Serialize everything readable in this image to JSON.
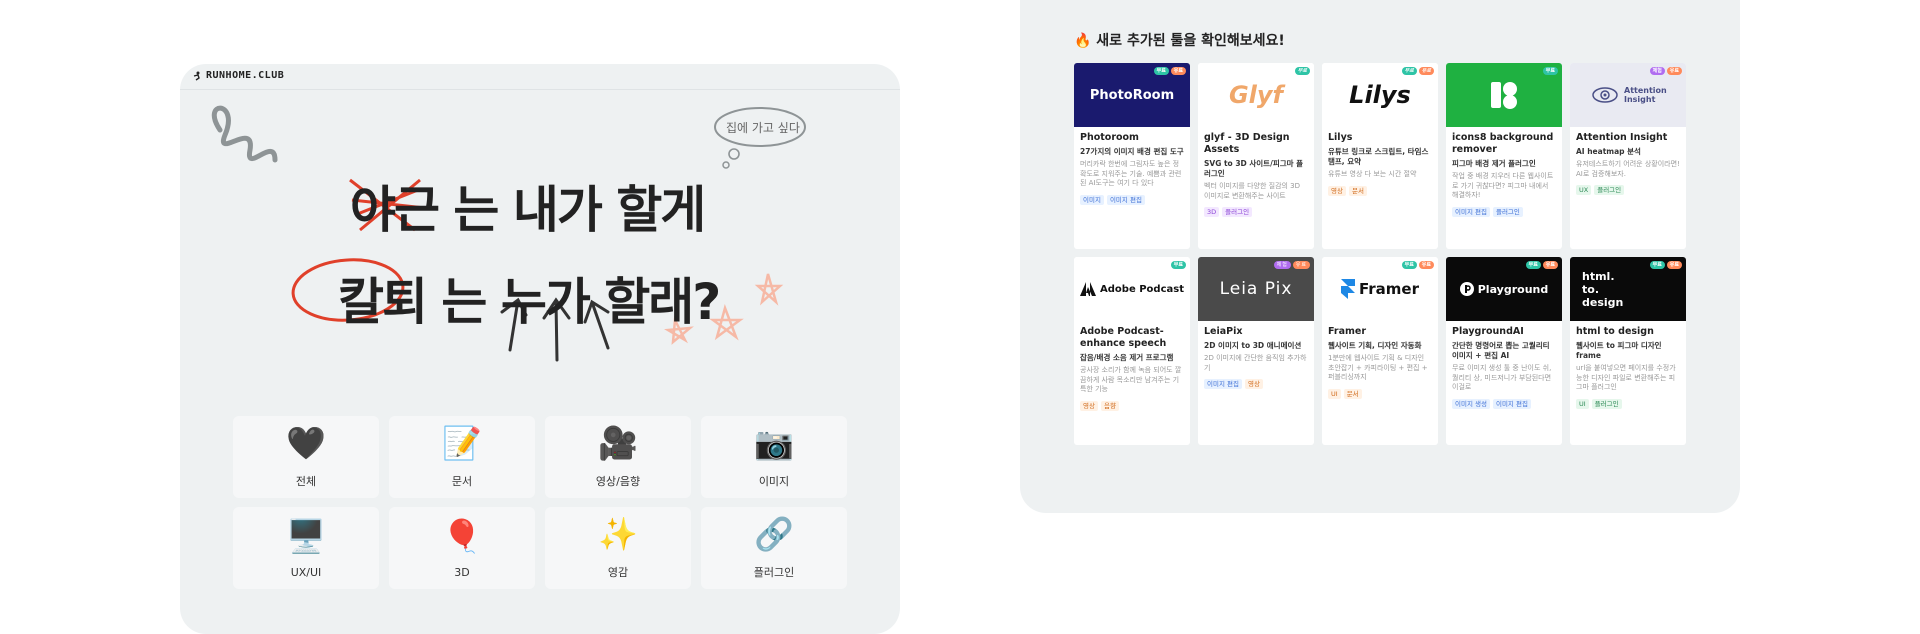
{
  "brand": {
    "name": "RUNHOME.CLUB"
  },
  "hero": {
    "scribble": "야근",
    "line1": "는 내가 할게",
    "line2_circled": "칼퇴",
    "line2": "는 누가 할래?",
    "bubble": "집에 가고 싶다"
  },
  "categories": [
    {
      "icon": "🖤",
      "label": "전체"
    },
    {
      "icon": "📝",
      "label": "문서"
    },
    {
      "icon": "🎥",
      "label": "영상/음향"
    },
    {
      "icon": "📷",
      "label": "이미지"
    },
    {
      "icon": "🖥️",
      "label": "UX/UI"
    },
    {
      "icon": "🎈",
      "label": "3D"
    },
    {
      "icon": "✨",
      "label": "영감"
    },
    {
      "icon": "🔗",
      "label": "플러그인"
    }
  ],
  "section": {
    "title": "🔥 새로 추가된 툴을 확인해보세요!"
  },
  "badges": {
    "free": "무료",
    "paid": "유료",
    "trial": "체험"
  },
  "tools": [
    {
      "logo": "PhotoRoom",
      "thumb_bg": "#1a1a6e",
      "thumb_fg": "#ffffff",
      "name": "Photoroom",
      "subtitle": "27가지의 이미지 배경 편집 도구",
      "description": "머리카락 한번에 그림자도 높은 정확도로 지워주는 기술. 예쁨과 관련된 AI도구는 여기 다 있다",
      "tags": [
        {
          "text": "이미지",
          "color": "blue"
        },
        {
          "text": "이미지 편집",
          "color": "blue"
        }
      ]
    },
    {
      "logo": "Glyf",
      "thumb_bg": "#ffffff",
      "thumb_fg": "#f0a76a",
      "name": "glyf - 3D Design Assets",
      "subtitle": "SVG to 3D 사이트/피그마 플러그인",
      "description": "벡터 이미지를 다양한 질감의 3D 이미지로 변환해주는 사이트",
      "tags": [
        {
          "text": "3D",
          "color": "purple"
        },
        {
          "text": "플러그인",
          "color": "purple"
        }
      ]
    },
    {
      "logo": "Lilys",
      "thumb_bg": "#ffffff",
      "thumb_fg": "#111111",
      "name": "Lilys",
      "subtitle": "유튜브 링크로 스크립트, 타임스탬프, 요약",
      "description": "유튜브 영상 다 보는 시간 절약",
      "tags": [
        {
          "text": "영상",
          "color": "orange"
        },
        {
          "text": "문서",
          "color": "orange"
        }
      ]
    },
    {
      "logo": "icons8",
      "thumb_bg": "#1fb141",
      "thumb_fg": "#ffffff",
      "name": "icons8 background remover",
      "subtitle": "피그마 배경 제거 플러그인",
      "description": "작업 중 배경 지우러 다른 웹사이트로 가기 귀찮다면? 피그마 내에서 해결하자!",
      "tags": [
        {
          "text": "이미지 편집",
          "color": "blue"
        },
        {
          "text": "플러그인",
          "color": "blue"
        }
      ]
    },
    {
      "logo": "Attention Insight",
      "thumb_bg": "#e9eaf2",
      "thumb_fg": "#4a4f86",
      "name": "Attention Insight",
      "subtitle": "AI heatmap 분석",
      "description": "유저테스트하기 어려운 상황이라면! AI로 검증해보자.",
      "tags": [
        {
          "text": "UX",
          "color": "green"
        },
        {
          "text": "플러그인",
          "color": "green"
        }
      ]
    },
    {
      "logo": "Adobe Podcast",
      "thumb_bg": "#ffffff",
      "thumb_fg": "#111111",
      "name": "Adobe Podcast-enhance speech",
      "subtitle": "잡음/배경 소음 제거 프로그램",
      "description": "공사장 소리가 함께 녹음 되어도 깔끔하게 사람 목소리만 남겨주는 기특한 기능",
      "tags": [
        {
          "text": "영상",
          "color": "orange"
        },
        {
          "text": "음향",
          "color": "orange"
        }
      ]
    },
    {
      "logo": "Leia Pix",
      "thumb_bg": "#4a4a4a",
      "thumb_fg": "#ffffff",
      "name": "LeiaPix",
      "subtitle": "2D 이미지 to 3D 애니메이션",
      "description": "2D 이미지에 간단한 움직임 추가하기",
      "tags": [
        {
          "text": "이미지 편집",
          "color": "blue"
        },
        {
          "text": "영상",
          "color": "orange"
        }
      ]
    },
    {
      "logo": "Framer",
      "thumb_bg": "#ffffff",
      "thumb_fg": "#111111",
      "name": "Framer",
      "subtitle": "웹사이트 기획, 디자인 자동화",
      "description": "1분만에 웹사이트 기획 & 디자인 초안잡기 + 카피라이팅 + 편집 + 퍼블리싱까지",
      "tags": [
        {
          "text": "UI",
          "color": "orange"
        },
        {
          "text": "문서",
          "color": "orange"
        }
      ]
    },
    {
      "logo": "Playground",
      "thumb_bg": "#0a0a0a",
      "thumb_fg": "#ffffff",
      "name": "PlaygroundAI",
      "subtitle": "간단한 명령어로 뽑는 고퀄리티 이미지 + 편집 AI",
      "description": "무료 이미지 생성 툴 중 난이도 쉬, 퀄리티 상, 미드저니가 부담된다면 이걸로",
      "tags": [
        {
          "text": "이미지 생성",
          "color": "blue"
        },
        {
          "text": "이미지 편집",
          "color": "blue"
        }
      ]
    },
    {
      "logo": "html. to. design",
      "thumb_bg": "#0a0a0a",
      "thumb_fg": "#ffffff",
      "name": "html to design",
      "subtitle": "웹사이트 to 피그마 디자인 frame",
      "description": "url을 붙여넣으면 페이지를 수정가능한 디자인 파일로 변환해주는 피그마 플러그인",
      "tags": [
        {
          "text": "UI",
          "color": "green"
        },
        {
          "text": "플러그인",
          "color": "green"
        }
      ]
    }
  ]
}
